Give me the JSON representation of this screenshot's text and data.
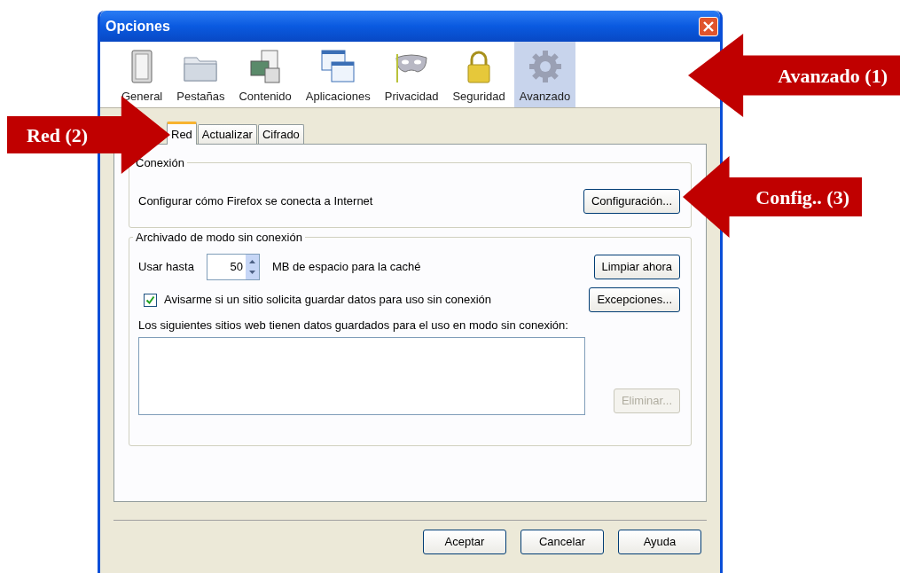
{
  "window": {
    "title": "Opciones"
  },
  "toolbar": [
    {
      "label": "General",
      "kind": "general",
      "selected": false
    },
    {
      "label": "Pestañas",
      "kind": "tabs",
      "selected": false
    },
    {
      "label": "Contenido",
      "kind": "content",
      "selected": false
    },
    {
      "label": "Aplicaciones",
      "kind": "apps",
      "selected": false
    },
    {
      "label": "Privacidad",
      "kind": "privacy",
      "selected": false
    },
    {
      "label": "Seguridad",
      "kind": "security",
      "selected": false
    },
    {
      "label": "Avanzado",
      "kind": "advanced",
      "selected": true
    }
  ],
  "subtabs": [
    {
      "label": "Red",
      "selected": true
    },
    {
      "label": "Actualizar",
      "selected": false
    },
    {
      "label": "Cifrado",
      "selected": false
    }
  ],
  "connection": {
    "legend": "Conexión",
    "text": "Configurar cómo Firefox se conecta a Internet",
    "button": "Configuración..."
  },
  "offline": {
    "legend": "Archivado de modo sin conexión",
    "use_label": "Usar hasta",
    "cache_value": "50",
    "cache_unit": "MB de espacio para la caché",
    "clear_button": "Limpiar ahora",
    "notify": {
      "label": "Avisarme si un sitio solicita guardar datos para uso sin conexión",
      "checked": true
    },
    "exceptions_button": "Excepciones...",
    "sites_label": "Los siguientes sitios web tienen datos guardados para el uso en modo sin conexión:",
    "remove_button": {
      "label": "Eliminar...",
      "disabled": true
    }
  },
  "buttons": [
    "Aceptar",
    "Cancelar",
    "Ayuda"
  ],
  "callouts": [
    {
      "label": "Avanzado (1)",
      "kind": "left"
    },
    {
      "label": "Red (2)",
      "kind": "right"
    },
    {
      "label": "Config.. (3)",
      "kind": "left"
    }
  ]
}
